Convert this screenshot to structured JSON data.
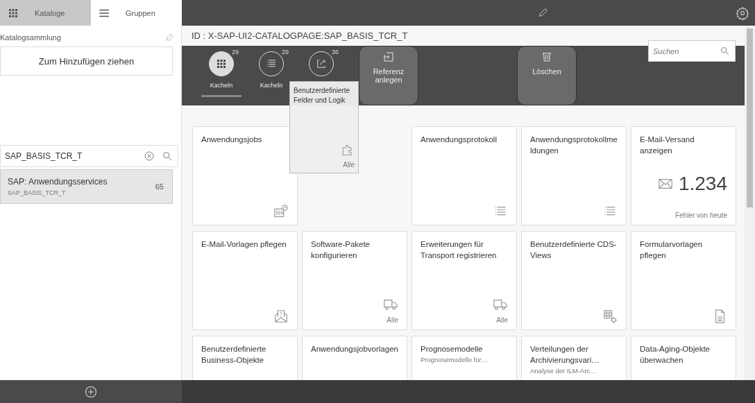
{
  "left_panel": {
    "tabs": [
      {
        "label": "Kataloge",
        "selected": true
      },
      {
        "label": "Gruppen",
        "selected": false
      }
    ],
    "section_title": "Katalogsammlung",
    "drop_target": "Zum Hinzufügen ziehen",
    "search": {
      "value": "SAP_BASIS_TCR_T"
    },
    "catalogs": [
      {
        "title": "SAP: Anwendungsservices",
        "subtitle": "SAP_BASIS_TCR_T",
        "count": "65",
        "selected": true
      }
    ]
  },
  "page_id": "ID : X-SAP-UI2-CATALOGPAGE:SAP_BASIS_TCR_T",
  "view_tabs": [
    {
      "label": "Kacheln",
      "count": "29",
      "selected": true
    },
    {
      "label": "Kacheln",
      "count": "29",
      "selected": false
    },
    {
      "count": "36",
      "selected": false
    }
  ],
  "drop_zones": [
    {
      "label": "Referenz anlegen"
    },
    {
      "label": "Löschen"
    }
  ],
  "search": {
    "placeholder": "Suchen"
  },
  "dragged_tile": {
    "title": "Benutzerdefinierte Felder und Logik",
    "footer": "Alle"
  },
  "tiles": [
    {
      "kind": "icon",
      "title": "Anwendungsjobs"
    },
    {
      "kind": "placeholder"
    },
    {
      "kind": "icon",
      "title": "Anwendungsprotokoll"
    },
    {
      "kind": "icon",
      "title": "Anwendungsprotokollmeldungen"
    },
    {
      "kind": "numeric",
      "title": "E-Mail-Versand anzeigen",
      "number": "1.234",
      "footer": "Fehler von heute"
    },
    {
      "kind": "icon",
      "title": "E-Mail-Vorlagen pflegen"
    },
    {
      "kind": "icon",
      "title": "Software-Pakete konfigurieren",
      "footer": "Alle"
    },
    {
      "kind": "icon",
      "title": "Erweiterungen für Transport registrieren",
      "footer": "Alle"
    },
    {
      "kind": "icon",
      "title": "Benutzerdefinierte CDS-Views"
    },
    {
      "kind": "icon",
      "title": "Formularvorlagen pflegen"
    },
    {
      "kind": "icon",
      "title": "Benutzerdefinierte Business-Objekte"
    },
    {
      "kind": "icon",
      "title": "Anwendungsjobvorlagen"
    },
    {
      "kind": "icon",
      "title": "Prognosemodelle",
      "subtitle": "Prognosemodelle für…"
    },
    {
      "kind": "icon",
      "title": "Verteilungen der Archivierungsvari…",
      "subtitle": "Analyse der ILM-Arc…"
    },
    {
      "kind": "icon",
      "title": "Data-Aging-Objekte überwachen"
    }
  ]
}
